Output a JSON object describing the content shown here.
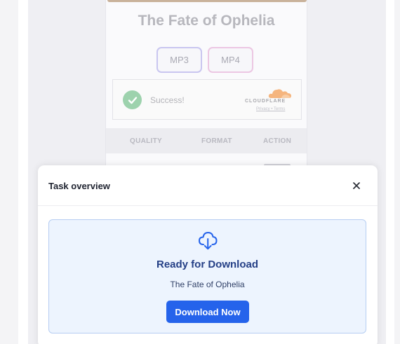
{
  "background": {
    "song_title": "The Fate of Ophelia",
    "formats": [
      {
        "label": "MP3"
      },
      {
        "label": "MP4"
      }
    ],
    "captcha": {
      "status": "Success!",
      "brand": "CLOUDFLARE",
      "links": "Privacy • Terms"
    },
    "table": {
      "headers": [
        "QUALITY",
        "FORMAT",
        "ACTION"
      ]
    }
  },
  "modal": {
    "title": "Task overview",
    "download": {
      "heading": "Ready for Download",
      "file_name": "The Fate of Ophelia",
      "button_label": "Download Now"
    }
  },
  "colors": {
    "accent": "#2563eb",
    "heading_blue": "#243f86",
    "card_bg": "#edf4fe",
    "card_border": "#b6cdf2",
    "success_green": "#9dd2ad",
    "cloudflare_orange": "#f5b57e"
  },
  "icons": {
    "download": "cloud-download-icon",
    "close": "close-icon",
    "check": "check-icon",
    "cloudflare": "cloudflare-logo"
  }
}
